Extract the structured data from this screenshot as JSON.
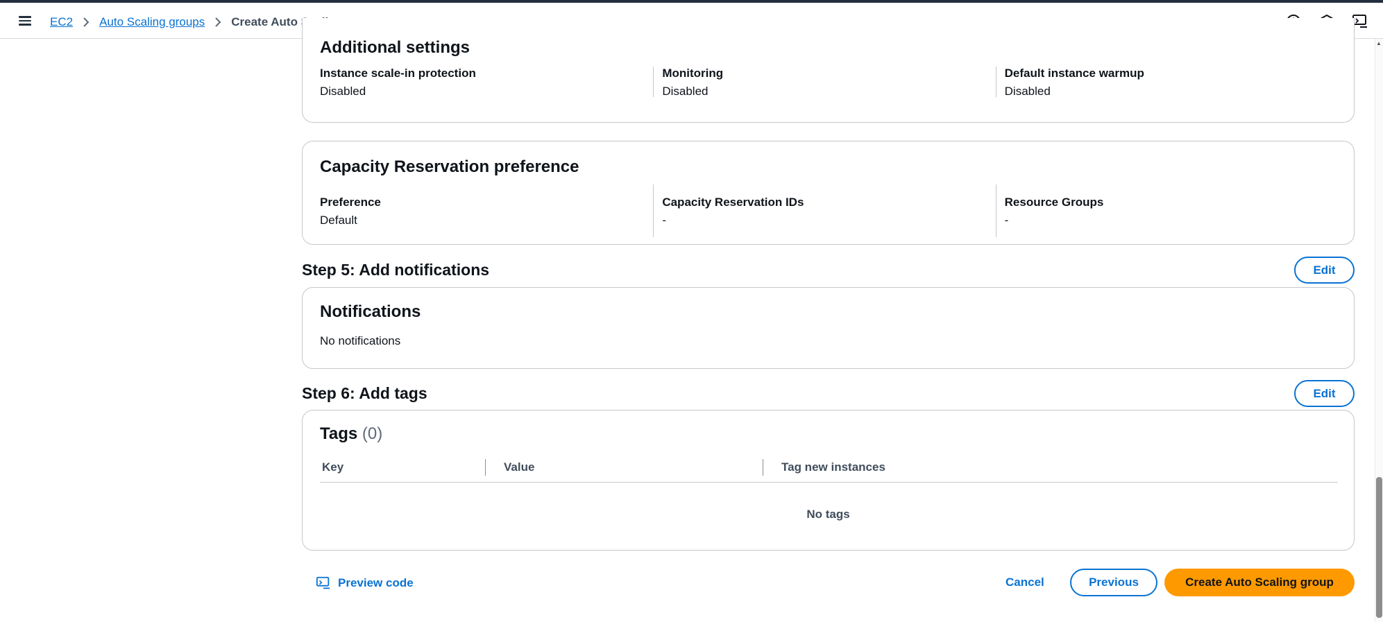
{
  "breadcrumb": {
    "items": [
      "EC2",
      "Auto Scaling groups"
    ],
    "current": "Create Auto Scaling group"
  },
  "header_icons": [
    "info-icon",
    "feedback-icon",
    "preview-code-icon"
  ],
  "additional_settings": {
    "title": "Additional settings",
    "fields": [
      {
        "label": "Instance scale-in protection",
        "value": "Disabled"
      },
      {
        "label": "Monitoring",
        "value": "Disabled"
      },
      {
        "label": "Default instance warmup",
        "value": "Disabled"
      }
    ]
  },
  "capacity_reservation": {
    "title": "Capacity Reservation preference",
    "fields": [
      {
        "label": "Preference",
        "value": "Default"
      },
      {
        "label": "Capacity Reservation IDs",
        "value": "-"
      },
      {
        "label": "Resource Groups",
        "value": "-"
      }
    ]
  },
  "step5": {
    "title": "Step 5: Add notifications",
    "edit_label": "Edit",
    "panel_title": "Notifications",
    "body": "No notifications"
  },
  "step6": {
    "title": "Step 6: Add tags",
    "edit_label": "Edit",
    "panel_title": "Tags",
    "count": "(0)",
    "columns": [
      "Key",
      "Value",
      "Tag new instances"
    ],
    "empty": "No tags"
  },
  "footer": {
    "preview_label": "Preview code",
    "cancel_label": "Cancel",
    "previous_label": "Previous",
    "create_label": "Create Auto Scaling group"
  },
  "colors": {
    "link": "#0972d3",
    "primary": "#ff9900",
    "border": "#c6c6cd",
    "text": "#0f141a"
  }
}
